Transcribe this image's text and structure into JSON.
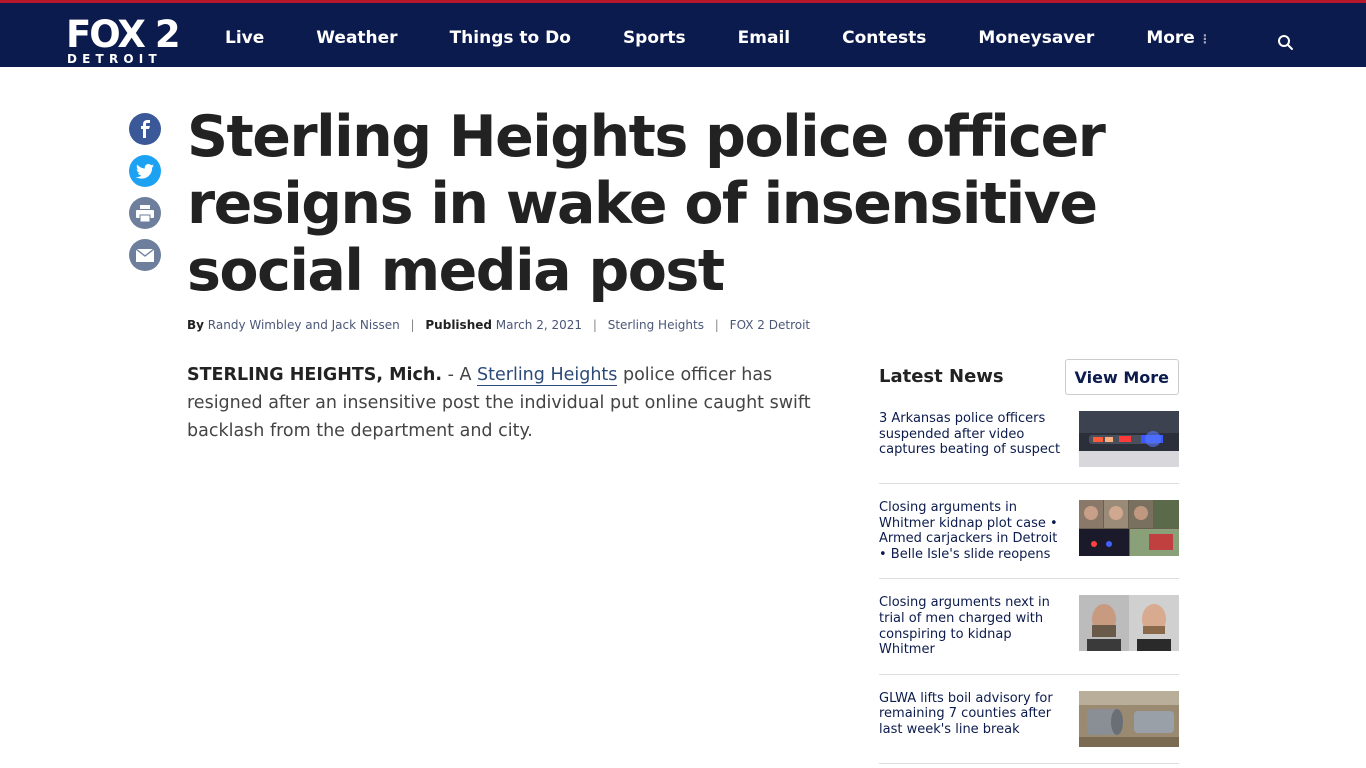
{
  "header": {
    "logo_main": "FOX 2",
    "logo_sub": "DETROIT",
    "nav": [
      "Live",
      "Weather",
      "Things to Do",
      "Sports",
      "Email",
      "Contests",
      "Moneysaver",
      "More"
    ],
    "more_dots": "⋮",
    "search_icon": "search-icon"
  },
  "social": {
    "icons": [
      "facebook-icon",
      "twitter-icon",
      "print-icon",
      "email-icon"
    ]
  },
  "article": {
    "headline": "Sterling Heights police officer resigns in wake of insensitive social media post",
    "byline_by": "By",
    "authors": "Randy Wimbley and Jack Nissen",
    "published_label": "Published",
    "published_date": "March 2, 2021",
    "tag": "Sterling Heights",
    "source": "FOX 2 Detroit",
    "dateline": "STERLING HEIGHTS, Mich.",
    "lead_prefix": " - A ",
    "lead_link": "Sterling Heights",
    "lead_rest": " police officer has resigned after an insensitive post the individual put online caught swift backlash from the department and city."
  },
  "sidebar": {
    "title": "Latest News",
    "view_more": "View More",
    "items": [
      {
        "title": "3 Arkansas police officers suspended after video captures beating of suspect"
      },
      {
        "title": "Closing arguments in Whitmer kidnap plot case • Armed carjackers in Detroit • Belle Isle's slide reopens"
      },
      {
        "title": "Closing arguments next in trial of men charged with conspiring to kidnap Whitmer"
      },
      {
        "title": "GLWA lifts boil advisory for remaining 7 counties after last week's line break"
      }
    ]
  },
  "colors": {
    "header_bg": "#0c1b4d",
    "accent_red": "#b5182b",
    "link": "#2b4a78"
  }
}
